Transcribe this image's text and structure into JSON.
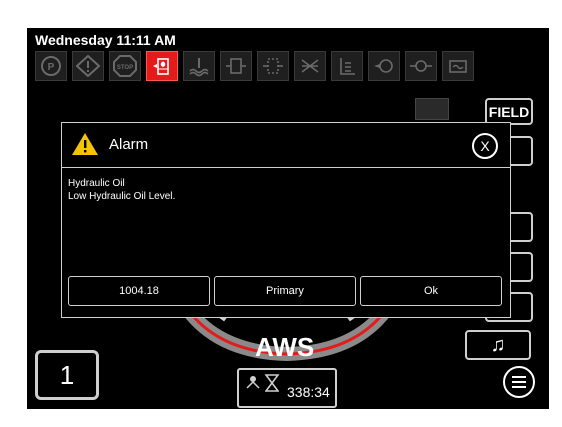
{
  "status_bar": {
    "datetime": "Wednesday 11:11 AM"
  },
  "indicators": [
    {
      "name": "parking-brake-icon",
      "active": false
    },
    {
      "name": "warning-icon",
      "active": false
    },
    {
      "name": "stop-icon",
      "label": "STOP",
      "active": false
    },
    {
      "name": "hydraulic-oil-icon",
      "active": true
    },
    {
      "name": "coolant-level-icon",
      "active": false
    },
    {
      "name": "fuel-filter-icon",
      "active": false
    },
    {
      "name": "hydraulic-filter-icon",
      "active": false
    },
    {
      "name": "air-filter-icon",
      "active": false
    },
    {
      "name": "transmission-oil-icon",
      "active": false
    },
    {
      "name": "oil-pressure-icon",
      "active": false
    },
    {
      "name": "engine-icon",
      "active": false
    },
    {
      "name": "battery-icon",
      "active": false
    }
  ],
  "colors": {
    "alarm_active": "#e31b1b",
    "warning_yellow": "#f5c400",
    "gauge_red": "#e31b1b"
  },
  "main": {
    "field_label": "FIELD",
    "gear_number": "1",
    "mode_label": "AWS",
    "timer_value": "338:34",
    "music_icon": "music-note-icon",
    "menu_icon": "menu-icon"
  },
  "alarm_dialog": {
    "title": "Alarm",
    "close_label": "X",
    "message_line1": "Hydraulic Oil",
    "message_line2": "Low Hydraulic Oil Level.",
    "buttons": [
      {
        "label": "1004.18"
      },
      {
        "label": "Primary"
      },
      {
        "label": "Ok"
      }
    ]
  }
}
